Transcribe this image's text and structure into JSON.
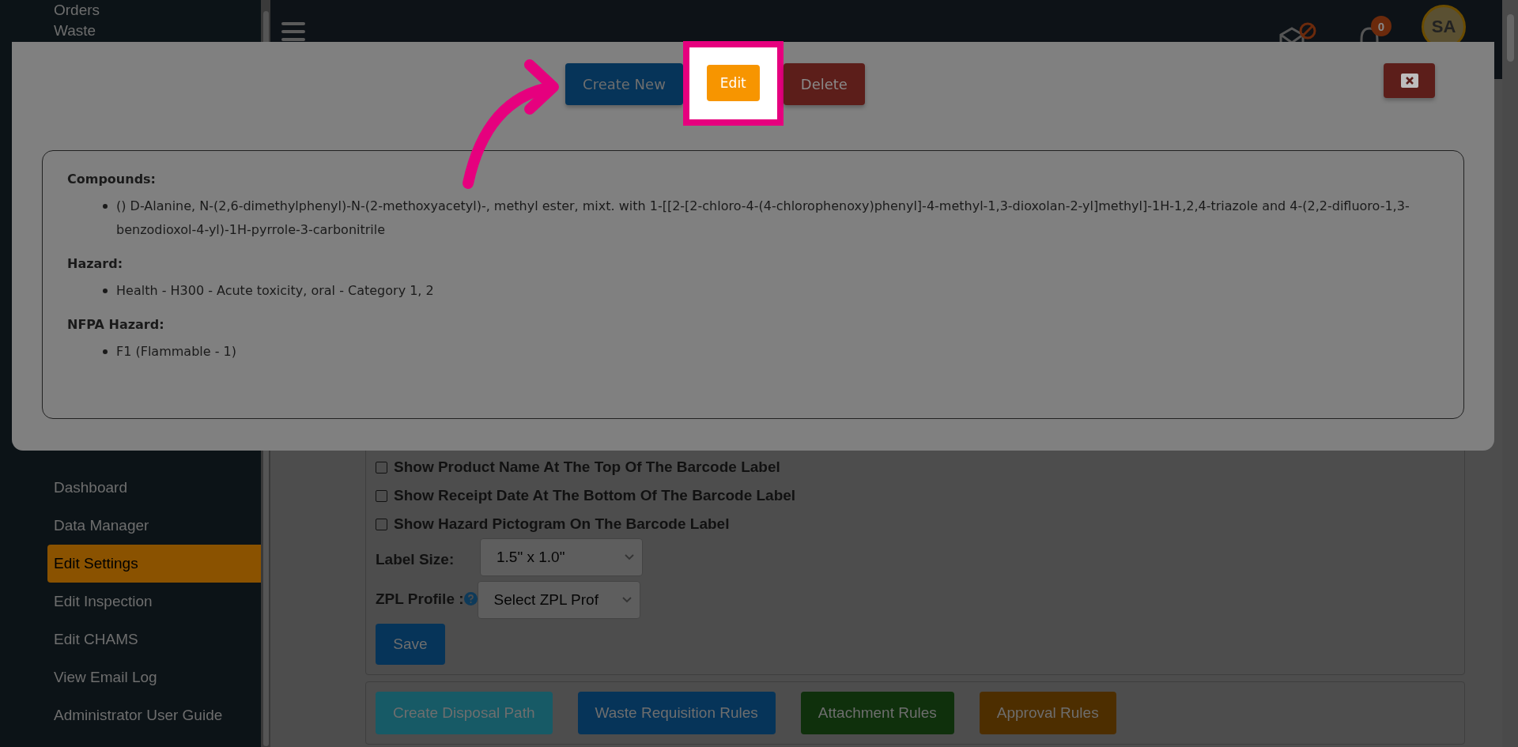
{
  "sidebar": {
    "items": [
      {
        "label": "Orders",
        "selected": false
      },
      {
        "label": "Waste",
        "selected": false
      },
      {
        "label": "Dashboard",
        "selected": false
      },
      {
        "label": "Data Manager",
        "selected": false
      },
      {
        "label": "Edit Settings",
        "selected": true
      },
      {
        "label": "Edit Inspection",
        "selected": false
      },
      {
        "label": "Edit CHAMS",
        "selected": false
      },
      {
        "label": "View Email Log",
        "selected": false
      },
      {
        "label": "Administrator User Guide",
        "selected": false
      }
    ]
  },
  "header": {
    "notification_count": "0",
    "avatar": "SA"
  },
  "settings": {
    "checkboxes": [
      {
        "label": "Show Product Name At The Top Of The Barcode Label",
        "checked": false
      },
      {
        "label": "Show Receipt Date At The Bottom Of The Barcode Label",
        "checked": false
      },
      {
        "label": "Show Hazard Pictogram On The Barcode Label",
        "checked": false
      }
    ],
    "label_size": {
      "label": "Label Size:",
      "value": "1.5\" x 1.0\""
    },
    "zpl_profile": {
      "label": "ZPL Profile :",
      "value": "Select ZPL Prof"
    },
    "save": "Save"
  },
  "rule_buttons": [
    {
      "label": "Create Disposal Path",
      "color": "#175a66"
    },
    {
      "label": "Waste Requisition Rules",
      "color": "#063459"
    },
    {
      "label": "Attachment Rules",
      "color": "#0f300c"
    },
    {
      "label": "Approval Rules",
      "color": "#4d2e00"
    }
  ],
  "modal": {
    "actions": [
      {
        "label": "Create New",
        "kind": "create",
        "highlighted": false
      },
      {
        "label": "Edit",
        "kind": "edit",
        "highlighted": true
      },
      {
        "label": "Delete",
        "kind": "delete",
        "highlighted": false
      }
    ],
    "sections": [
      {
        "heading": "Compounds:",
        "items": [
          "() D-Alanine, N-(2,6-dimethylphenyl)-N-(2-methoxyacetyl)-, methyl ester, mixt. with 1-[[2-[2-chloro-4-(4-chlorophenoxy)phenyl]-4-methyl-1,3-dioxolan-2-yl]methyl]-1H-1,2,4-triazole and 4-(2,2-difluoro-1,3-benzodioxol-4-yl)-1H-pyrrole-3-carbonitrile"
        ]
      },
      {
        "heading": "Hazard:",
        "items": [
          "Health - H300 - Acute toxicity, oral - Category 1, 2"
        ]
      },
      {
        "heading": "NFPA Hazard:",
        "items": [
          "F1 (Flammable - 1)"
        ]
      }
    ]
  }
}
